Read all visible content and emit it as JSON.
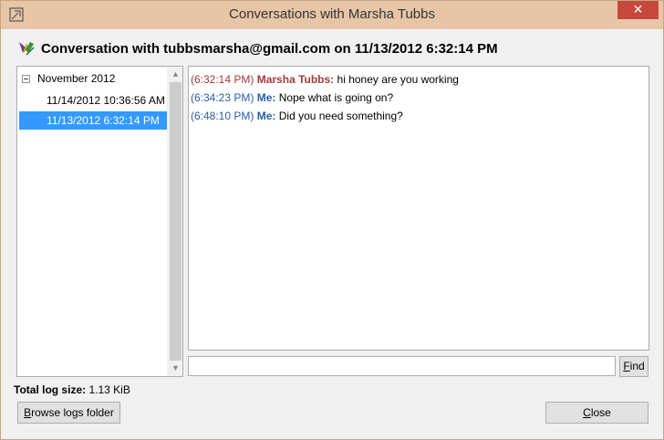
{
  "window": {
    "title": "Conversations with Marsha Tubbs"
  },
  "header": {
    "icon": "pidgin-icon",
    "title": "Conversation with tubbsmarsha@gmail.com on 11/13/2012 6:32:14 PM"
  },
  "tree": {
    "group": "November 2012",
    "items": [
      {
        "label": "11/14/2012 10:36:56 AM",
        "selected": false
      },
      {
        "label": "11/13/2012 6:32:14 PM",
        "selected": true
      }
    ]
  },
  "log": {
    "messages": [
      {
        "time": "(6:32:14 PM)",
        "sender": "Marsha Tubbs:",
        "text": "hi honey are you working",
        "who": "them"
      },
      {
        "time": "(6:34:23 PM)",
        "sender": "Me:",
        "text": "Nope what is going on?",
        "who": "me"
      },
      {
        "time": "(6:48:10 PM)",
        "sender": "Me:",
        "text": "Did you need something?",
        "who": "me"
      }
    ]
  },
  "search": {
    "value": "",
    "find_first": "F",
    "find_rest": "ind"
  },
  "footer": {
    "logsize_label": "Total log size:",
    "logsize_value": "1.13 KiB",
    "browse_first": "B",
    "browse_rest": "rowse logs folder",
    "close_first": "C",
    "close_rest": "lose"
  },
  "colors": {
    "titlebar": "#e7c6a7",
    "selection": "#3399ff",
    "them": "#a33a3a",
    "me": "#2c5da8",
    "close_button": "#c7483d"
  }
}
